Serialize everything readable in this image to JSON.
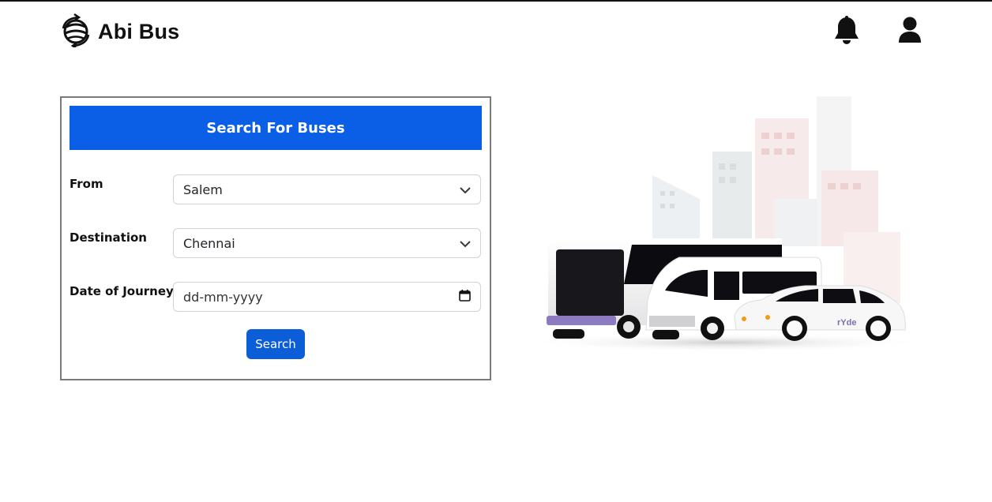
{
  "header": {
    "brand": "Abi Bus",
    "logo_icon": "globe-arrows-icon",
    "notification_icon": "bell-icon",
    "profile_icon": "user-icon"
  },
  "search_card": {
    "title": "Search For Buses",
    "from_label": "From",
    "from_value": "Salem",
    "destination_label": "Destination",
    "destination_value": "Chennai",
    "date_label": "Date of Journey",
    "date_placeholder": "dd-mm-yyyy",
    "search_button": "Search"
  },
  "hero": {
    "car_brand": "rYde"
  },
  "colors": {
    "primary": "#0a5fe6",
    "button": "#0b5ed7"
  }
}
